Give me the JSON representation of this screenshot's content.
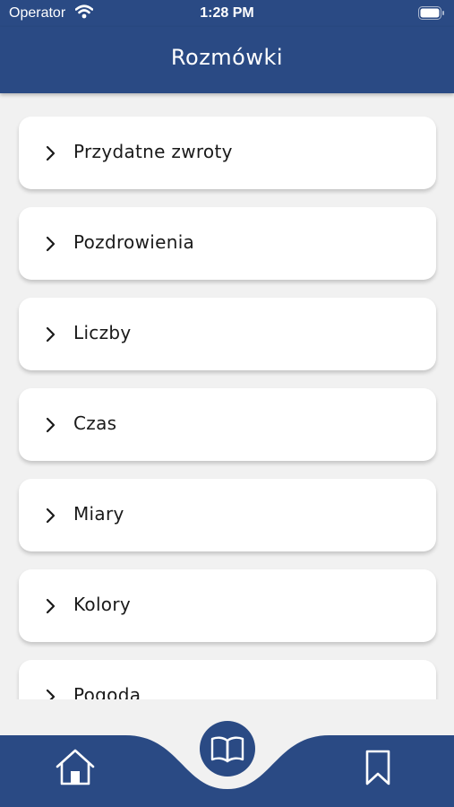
{
  "status_bar": {
    "carrier": "Operator",
    "time": "1:28 PM",
    "wifi_icon": "wifi-icon",
    "battery_icon": "battery-icon"
  },
  "header": {
    "title": "Rozmówki"
  },
  "categories": {
    "items": [
      {
        "label": "Przydatne zwroty",
        "icon": "chevron-right-icon"
      },
      {
        "label": "Pozdrowienia",
        "icon": "chevron-right-icon"
      },
      {
        "label": "Liczby",
        "icon": "chevron-right-icon"
      },
      {
        "label": "Czas",
        "icon": "chevron-right-icon"
      },
      {
        "label": "Miary",
        "icon": "chevron-right-icon"
      },
      {
        "label": "Kolory",
        "icon": "chevron-right-icon"
      },
      {
        "label": "Pogoda",
        "icon": "chevron-right-icon"
      }
    ]
  },
  "tab_bar": {
    "tabs": [
      {
        "icon": "home-icon",
        "active": false
      },
      {
        "icon": "open-book-icon",
        "active": true
      },
      {
        "icon": "bookmark-icon",
        "active": false
      }
    ]
  },
  "colors": {
    "primary": "#2a4a84",
    "background": "#f1f1f1",
    "card": "#ffffff",
    "text": "#1a1a1a",
    "on_primary": "#ffffff"
  }
}
